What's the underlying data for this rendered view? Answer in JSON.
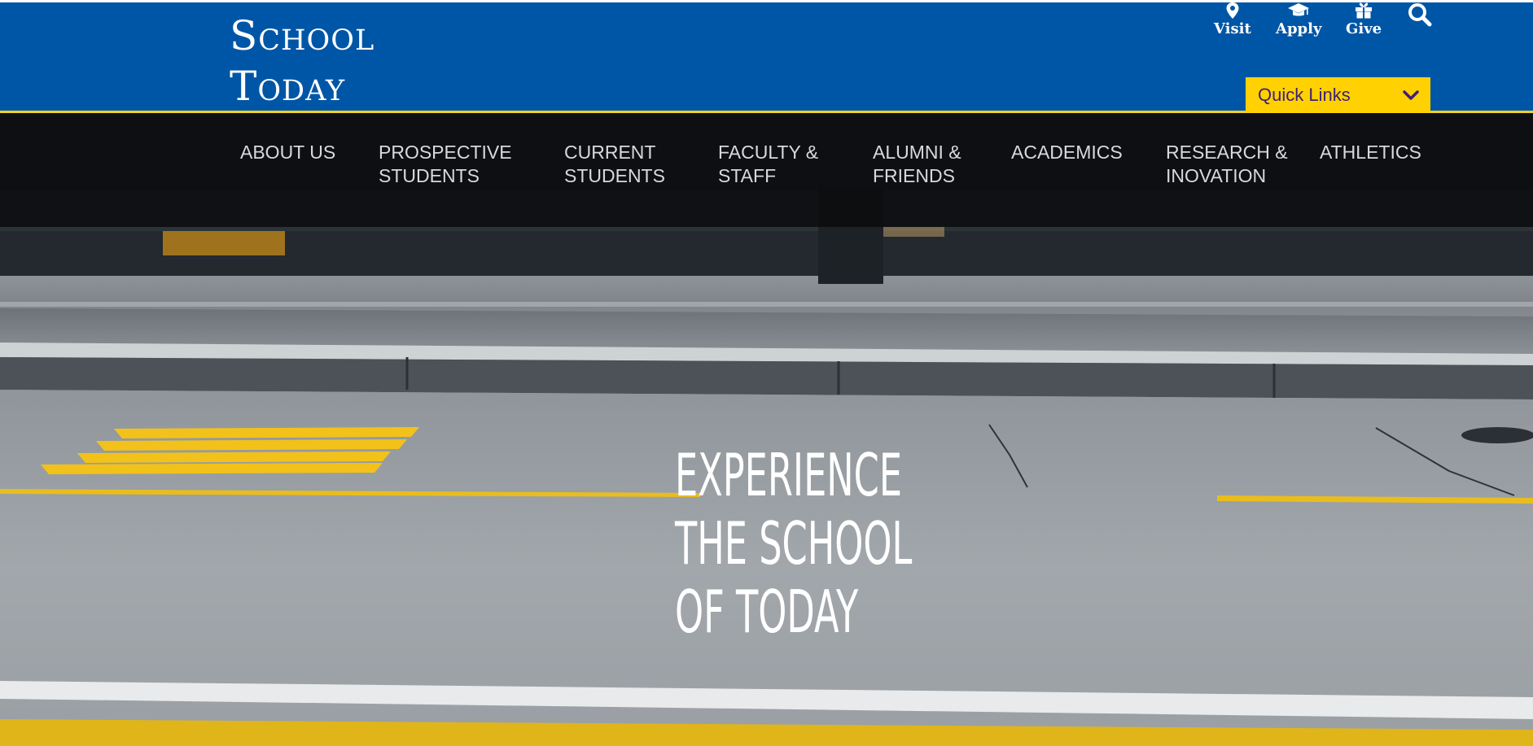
{
  "brand": {
    "logo_line1": "School",
    "logo_line2": "Today",
    "header_color": "#0056a6",
    "accent_color": "#ffd100",
    "quick_links_text_color": "#3e1f7a"
  },
  "utility_nav": [
    {
      "label": "Visit",
      "icon": "map-marker-icon"
    },
    {
      "label": "Apply",
      "icon": "graduation-cap-icon"
    },
    {
      "label": "Give",
      "icon": "gift-icon"
    }
  ],
  "search": {
    "icon": "search-icon"
  },
  "quick_links": {
    "label": "Quick Links",
    "icon": "chevron-down-icon"
  },
  "main_nav": [
    {
      "line1": "About Us",
      "line2": ""
    },
    {
      "line1": "Prospective",
      "line2": "Students"
    },
    {
      "line1": "Current",
      "line2": "Students"
    },
    {
      "line1": "Faculty &",
      "line2": "Staff"
    },
    {
      "line1": "Alumni &",
      "line2": "Friends"
    },
    {
      "line1": "Academics",
      "line2": ""
    },
    {
      "line1": "Research &",
      "line2": "Inovation"
    },
    {
      "line1": "Athletics",
      "line2": ""
    }
  ],
  "hero": {
    "line1": "EXPERIENCE",
    "line2": "THE SCHOOL",
    "line3": "OF TODAY"
  }
}
